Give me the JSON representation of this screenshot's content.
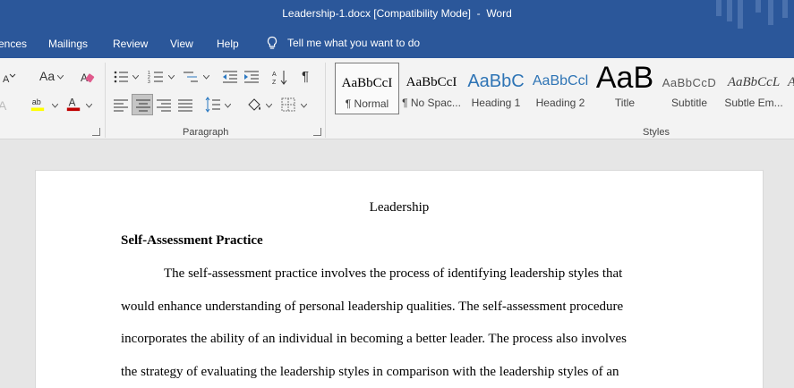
{
  "titlebar": {
    "title": "Leadership-1.docx [Compatibility Mode]  -  Word"
  },
  "menubar": {
    "tabs": [
      "ences",
      "Mailings",
      "Review",
      "View",
      "Help"
    ],
    "tell_me": "Tell me what you want to do"
  },
  "ribbon": {
    "font_group": {
      "font_size_glyph": "Aa"
    },
    "paragraph_label": "Paragraph",
    "styles_label": "Styles",
    "styles": [
      {
        "sample": "AaBbCcI",
        "name": "¶ Normal"
      },
      {
        "sample": "AaBbCcI",
        "name": "¶ No Spac..."
      },
      {
        "sample": "AaBbC",
        "name": "Heading 1"
      },
      {
        "sample": "AaBbCcl",
        "name": "Heading 2"
      },
      {
        "sample": "AaB",
        "name": "Title"
      },
      {
        "sample": "AaBbCcD",
        "name": "Subtitle"
      },
      {
        "sample": "AaBbCcL",
        "name": "Subtle Em..."
      }
    ]
  },
  "document": {
    "title": "Leadership",
    "heading": "Self-Assessment Practice",
    "lines": [
      "The self-assessment practice involves the process of identifying leadership styles that",
      "would enhance understanding of personal leadership qualities. The self-assessment procedure",
      "incorporates the ability of an individual in becoming a better leader. The process also involves",
      "the strategy of evaluating the leadership styles in comparison with the leadership styles of an"
    ]
  },
  "colors": {
    "title_bar": "#2b579a",
    "ribbon": "#f3f3f3",
    "canvas": "#e6e6e6",
    "highlight": "#ffff00",
    "font_color": "#c00000"
  }
}
